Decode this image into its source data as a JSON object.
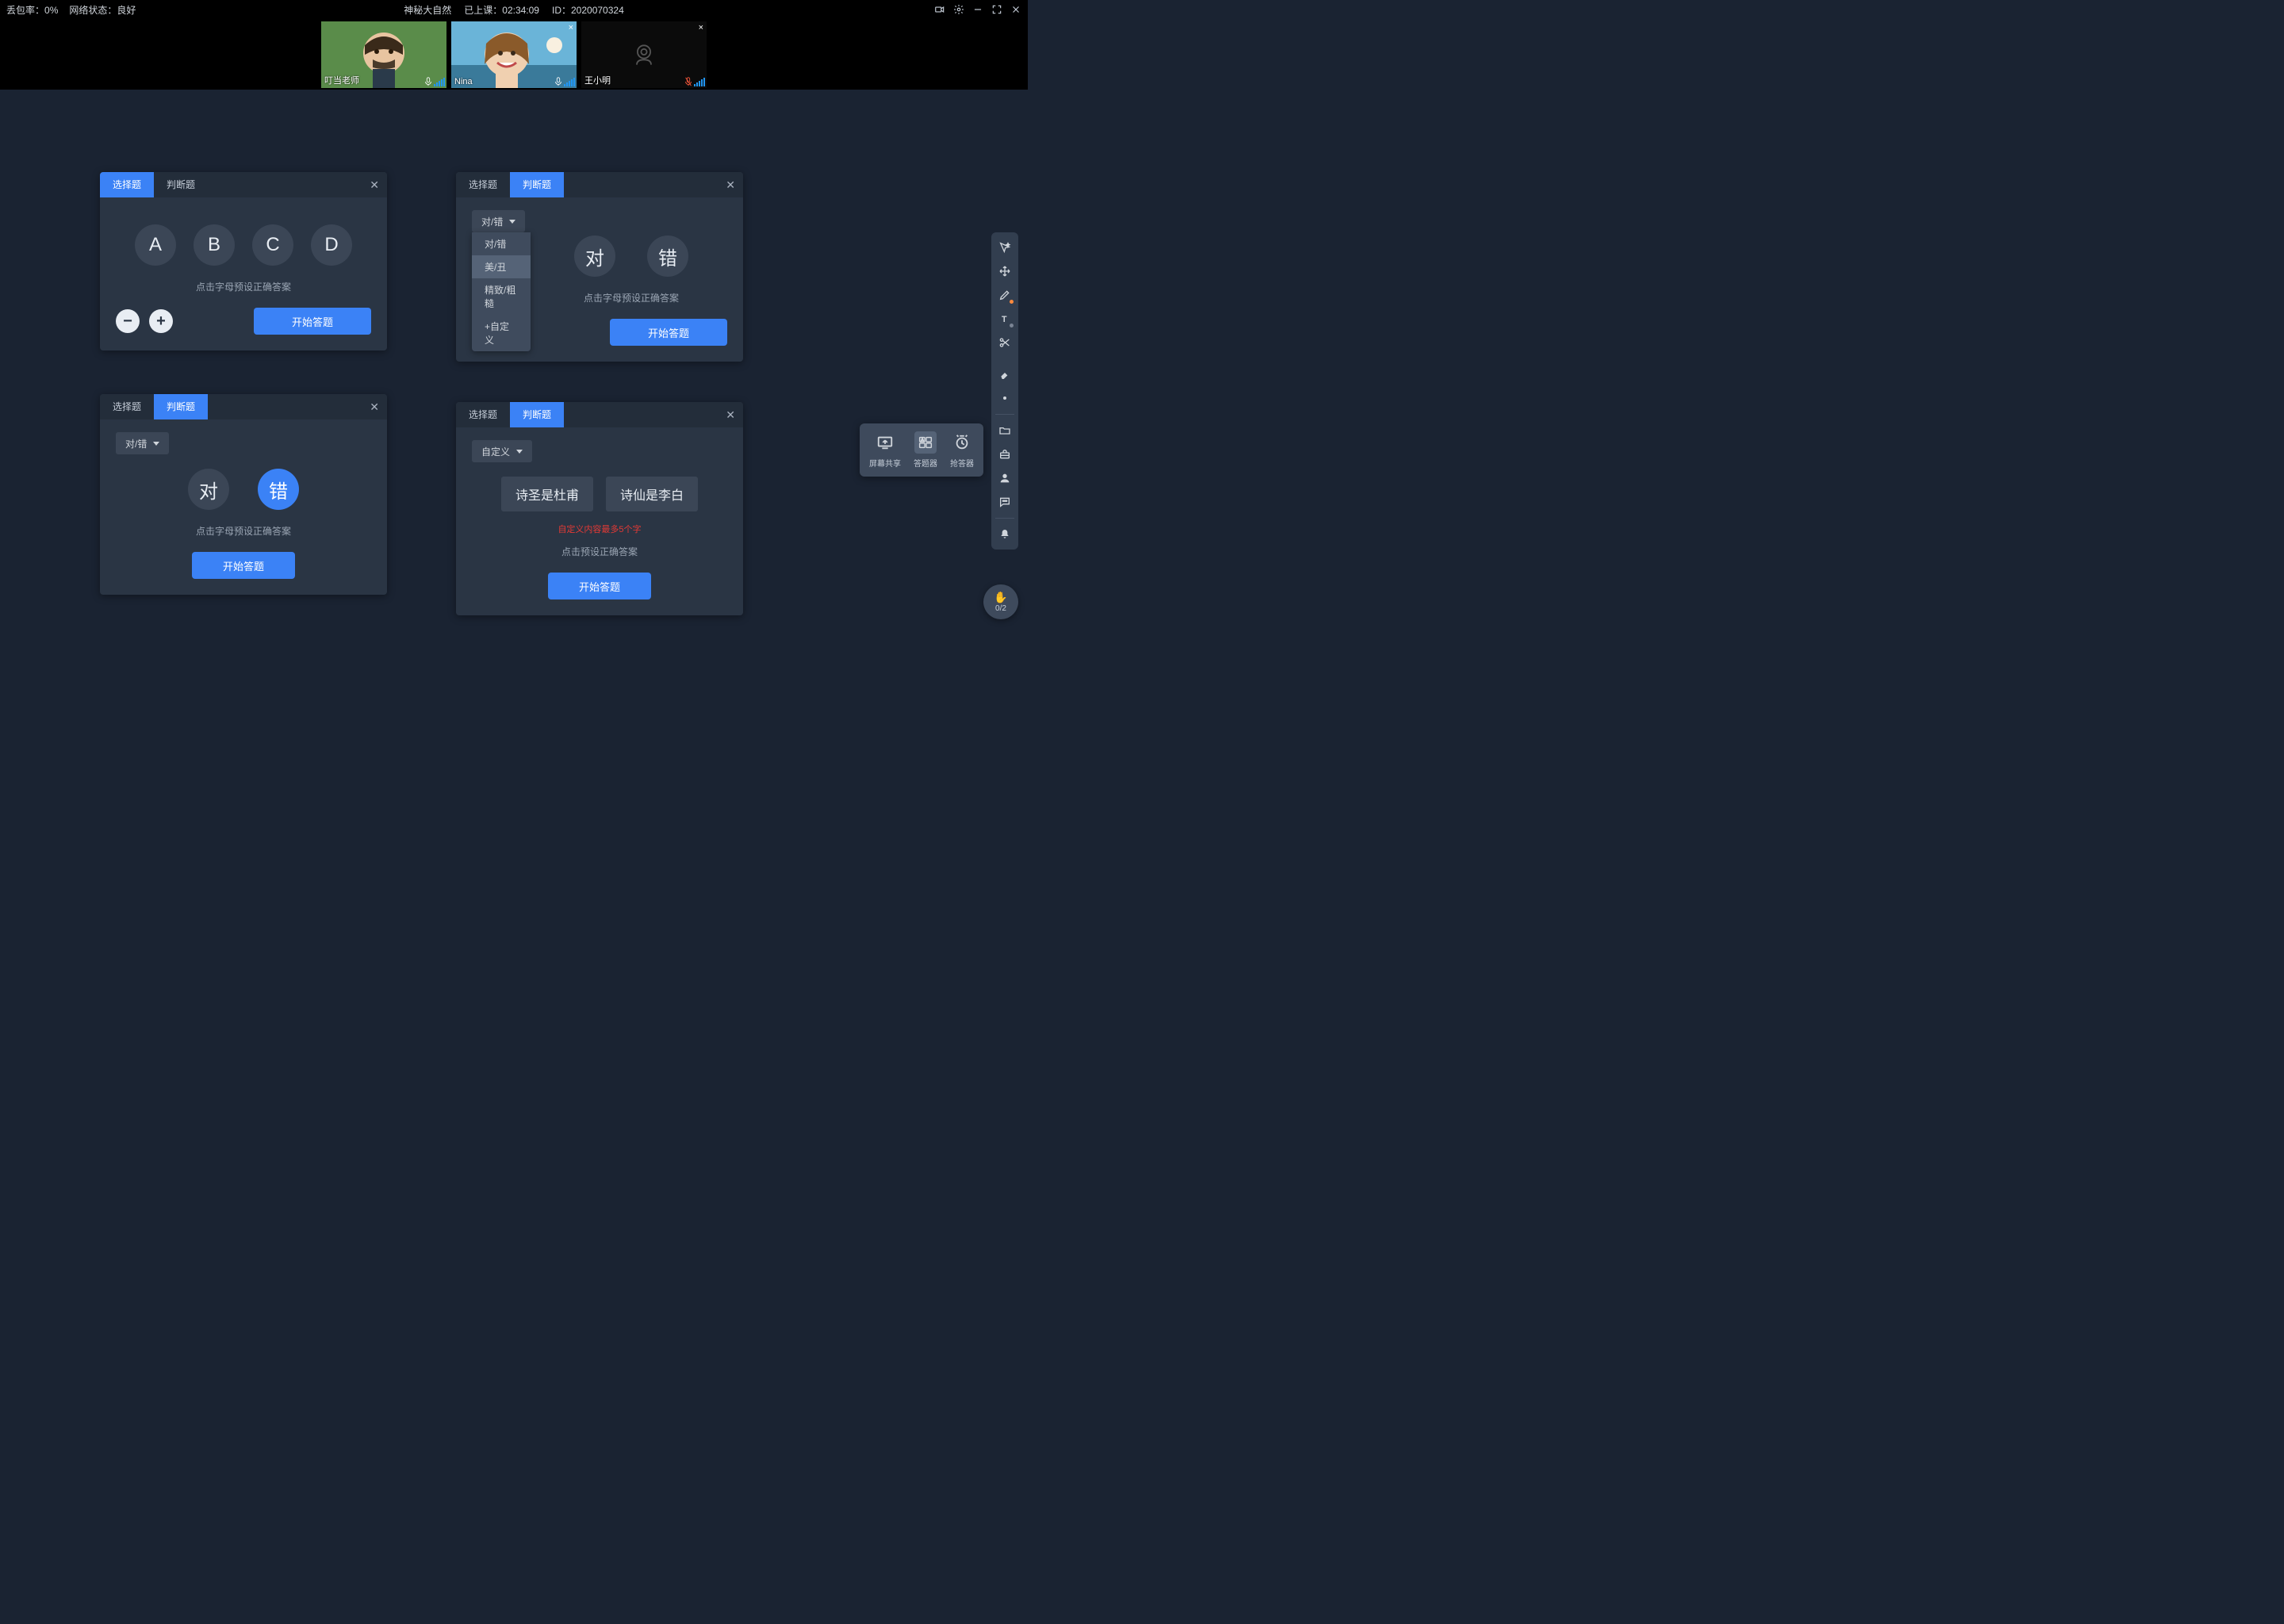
{
  "topbar": {
    "packet_loss_label": "丢包率：",
    "packet_loss_value": "0%",
    "network_label": "网络状态：",
    "network_value": "良好",
    "title": "神秘大自然",
    "elapsed_label": "已上课：",
    "elapsed_value": "02:34:09",
    "id_label": "ID：",
    "id_value": "2020070324"
  },
  "videos": {
    "v0": {
      "name": "叮当老师"
    },
    "v1": {
      "name": "Nina"
    },
    "v2": {
      "name": "王小明"
    }
  },
  "panels": {
    "choice": {
      "tab1": "选择题",
      "tab2": "判断题",
      "options": {
        "a": "A",
        "b": "B",
        "c": "C",
        "d": "D"
      },
      "hint": "点击字母预设正确答案",
      "start": "开始答题"
    },
    "tf_dropdown": {
      "tab1": "选择题",
      "tab2": "判断题",
      "dd_label": "对/错",
      "menu": {
        "m0": "对/错",
        "m1": "美/丑",
        "m2": "精致/粗糙",
        "m3": "+自定义"
      },
      "opt_true": "对",
      "opt_false": "错",
      "hint": "点击字母预设正确答案",
      "start": "开始答题"
    },
    "tf_selected": {
      "tab1": "选择题",
      "tab2": "判断题",
      "dd_label": "对/错",
      "opt_true": "对",
      "opt_false": "错",
      "hint": "点击字母预设正确答案",
      "start": "开始答题"
    },
    "custom": {
      "tab1": "选择题",
      "tab2": "判断题",
      "dd_label": "自定义",
      "opt1": "诗圣是杜甫",
      "opt2": "诗仙是李白",
      "err": "自定义内容最多5个字",
      "hint": "点击预设正确答案",
      "start": "开始答题"
    }
  },
  "popup": {
    "share": "屏幕共享",
    "answerer": "答题器",
    "responder": "抢答器"
  },
  "hand": {
    "count": "0/2"
  },
  "colors": {
    "accent": "#3b82f6",
    "panel_bg": "#2a3544"
  }
}
